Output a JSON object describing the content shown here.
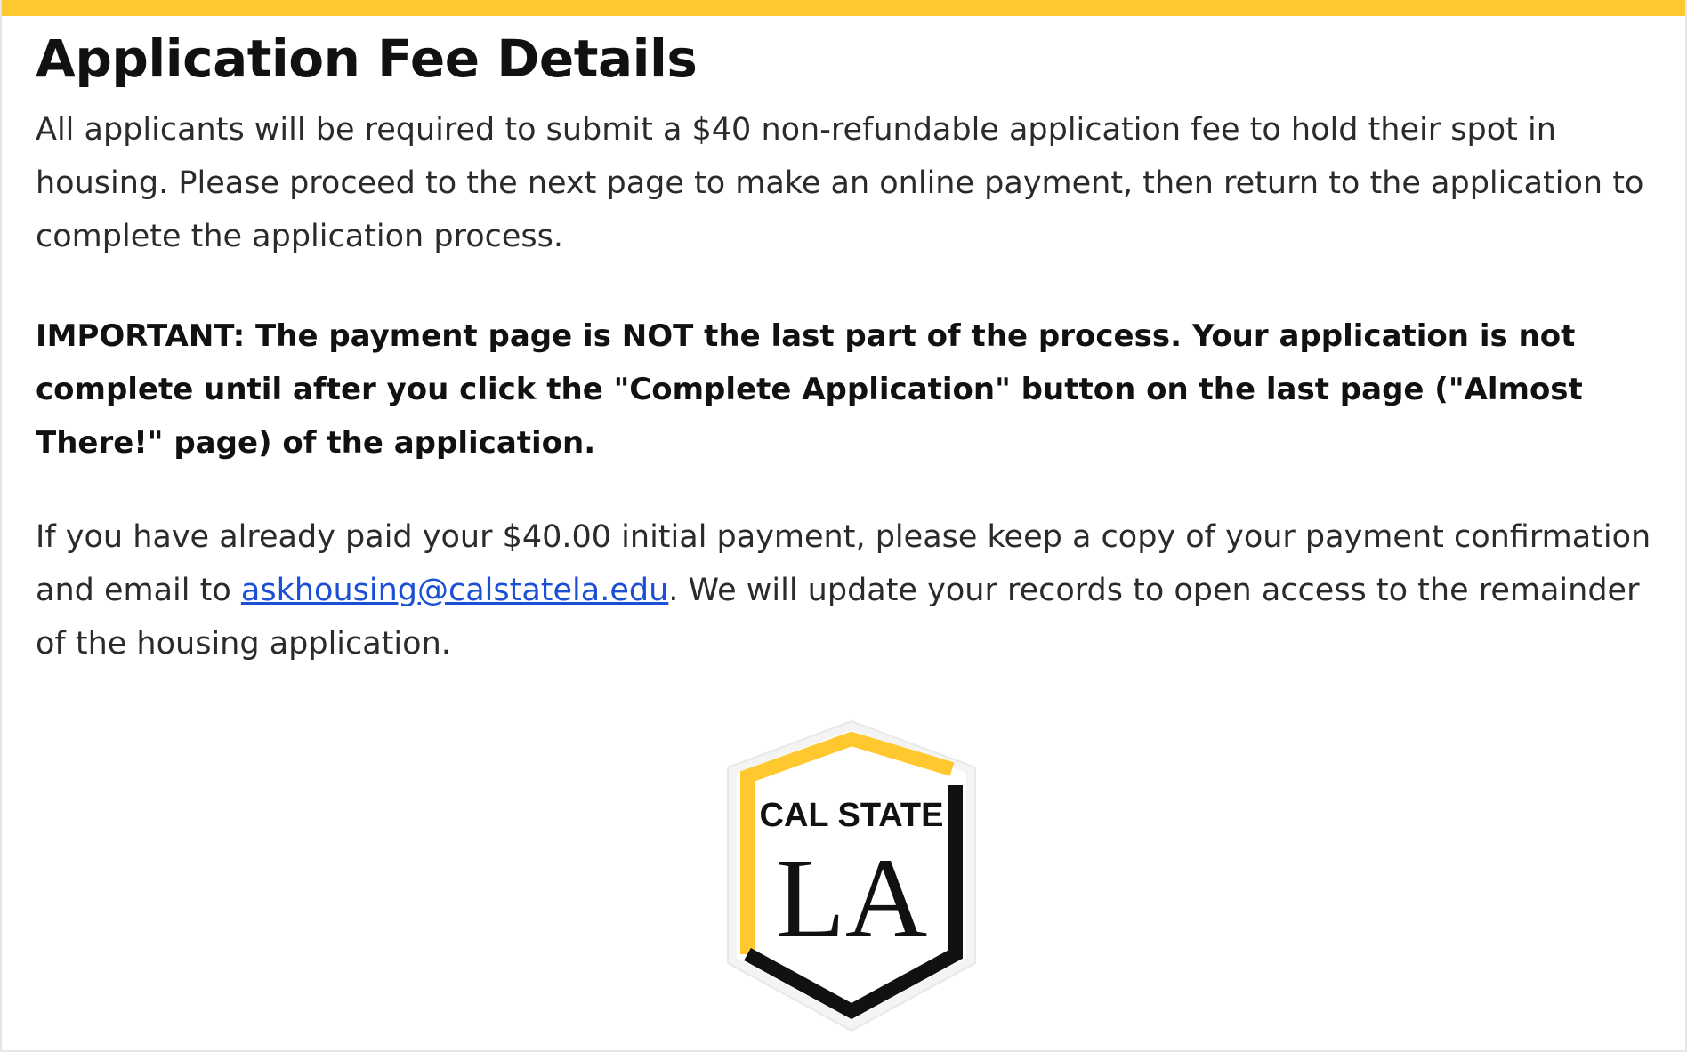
{
  "header": {
    "title": "Application Fee Details"
  },
  "body": {
    "intro": "All applicants will be required to submit a $40 non-refundable application fee to hold their spot in housing. Please proceed to the next page to make an online payment, then return to the application to complete the application process.",
    "important": "IMPORTANT: The payment page is NOT the last part of the process. Your application is not complete until after you click the \"Complete Application\" button on the last page (\"Almost There!\" page) of the application.",
    "paid_before_link": "If you have already paid your $40.00 initial payment, please keep a copy of your payment confirmation and email to ",
    "email": "askhousing@calstatela.edu",
    "paid_after_link": ". We will update your records to open access to the remainder of the housing application."
  },
  "logo": {
    "line1": "CAL STATE",
    "line2": "LA",
    "colors": {
      "gold": "#ffc82e",
      "black": "#111111"
    }
  },
  "colors": {
    "accent_bar": "#ffc82e",
    "link": "#1a4fd6"
  }
}
